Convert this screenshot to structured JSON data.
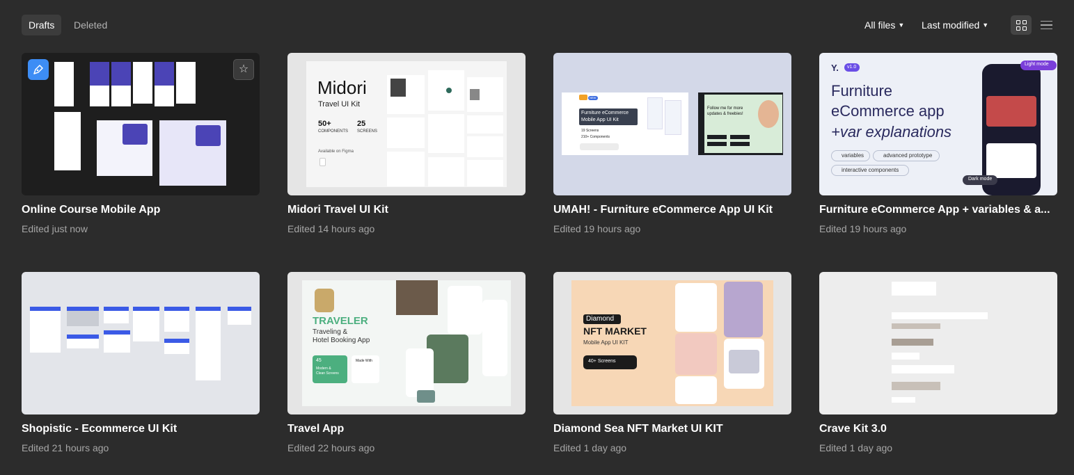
{
  "tabs": [
    {
      "label": "Drafts",
      "active": true
    },
    {
      "label": "Deleted",
      "active": false
    }
  ],
  "filters": {
    "files_label": "All files",
    "sort_label": "Last modified"
  },
  "view_modes": {
    "grid_icon": "grid-view-icon",
    "list_icon": "list-view-icon",
    "active": "grid"
  },
  "colors": {
    "background": "#2c2c2c",
    "accent": "#3d8df5",
    "text_secondary": "#a6a6a6"
  },
  "files": [
    {
      "title": "Online Course Mobile App",
      "edited": "Edited just now",
      "favorite_icon": "star-icon",
      "type_icon": "pen-icon"
    },
    {
      "title": "Midori Travel UI Kit",
      "edited": "Edited 14 hours ago"
    },
    {
      "title": "UMAH! - Furniture eCommerce App UI Kit",
      "edited": "Edited 19 hours ago"
    },
    {
      "title": "Furniture eCommerce App + variables & a...",
      "edited": "Edited 19 hours ago"
    },
    {
      "title": "Shopistic - Ecommerce UI Kit",
      "edited": "Edited 21 hours ago"
    },
    {
      "title": "Travel App",
      "edited": "Edited 22 hours ago"
    },
    {
      "title": "Diamond Sea NFT Market UI KIT",
      "edited": "Edited 1 day ago"
    },
    {
      "title": "Crave Kit 3.0",
      "edited": "Edited 1 day ago"
    }
  ],
  "thumbnails": {
    "midori": {
      "title": "Midori",
      "subtitle": "Travel UI Kit",
      "stat1_num": "50+",
      "stat1_label": "COMPONENTS",
      "stat2_num": "25",
      "stat2_label": "SCREENS",
      "note": "Available on Figma"
    },
    "umah": {
      "badge": "NEW",
      "heading": "Furniture eCommerce Mobile App UI Kit",
      "stat1": "19 Screens",
      "stat2": "210+ Components",
      "promo": "Follow me for more updates & freebies!"
    },
    "furniture": {
      "version": "v1.0",
      "line1": "Furniture",
      "line2": "eCommerce app",
      "line3": "+var explanations",
      "chip1": "variables",
      "chip2": "advanced prototype",
      "chip3": "interactive components",
      "light_mode": "Light mode",
      "dark_mode": "Dark mode"
    },
    "traveler": {
      "title": "TRAVELER",
      "line1": "Traveling &",
      "line2": "Hotel Booking App",
      "count": "45",
      "count_label1": "Modern &",
      "count_label2": "Clean Screens",
      "made_with": "Made With"
    },
    "nft": {
      "brand": "Diamond",
      "title": "NFT MARKET",
      "subtitle": "Mobile App UI KIT",
      "badge": "40+ Screens"
    }
  }
}
